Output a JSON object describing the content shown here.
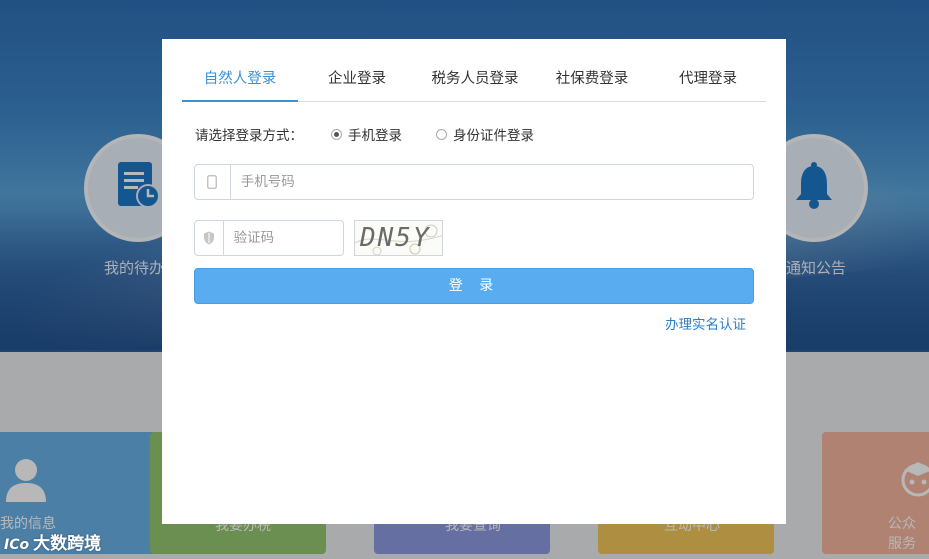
{
  "background": {
    "left_feature_label": "我的待办",
    "right_feature_label": "通知公告",
    "left_feature_icon": "task-list-clock-icon",
    "right_feature_icon": "bell-icon",
    "tiles": [
      {
        "label": "我的信息",
        "color": "#6ab0e6",
        "icon": "user-icon"
      },
      {
        "label": "我要办税",
        "color": "#93c770"
      },
      {
        "label": "我要查询",
        "color": "#8e9ae0"
      },
      {
        "label": "互动中心",
        "color": "#f1c75a"
      },
      {
        "label": "公众服务",
        "color": "#f4b49e",
        "icon": "mascot-icon"
      }
    ],
    "watermark": "大数跨境",
    "watermark_logo": "ICo"
  },
  "dialog": {
    "tabs": [
      {
        "label": "自然人登录",
        "active": true
      },
      {
        "label": "企业登录",
        "active": false
      },
      {
        "label": "税务人员登录",
        "active": false
      },
      {
        "label": "社保费登录",
        "active": false
      },
      {
        "label": "代理登录",
        "active": false
      }
    ],
    "login_method_label": "请选择登录方式：",
    "login_methods": [
      {
        "label": "手机登录",
        "selected": true
      },
      {
        "label": "身份证件登录",
        "selected": false
      }
    ],
    "phone_placeholder": "手机号码",
    "phone_icon": "mobile-phone-icon",
    "code_placeholder": "验证码",
    "code_icon": "shield-icon",
    "captcha_text": "DN5Y",
    "login_button": "登 录",
    "realname_link": "办理实名认证"
  },
  "colors": {
    "accent": "#3c90d6",
    "button": "#5aacf0",
    "link": "#2f7fc4"
  }
}
